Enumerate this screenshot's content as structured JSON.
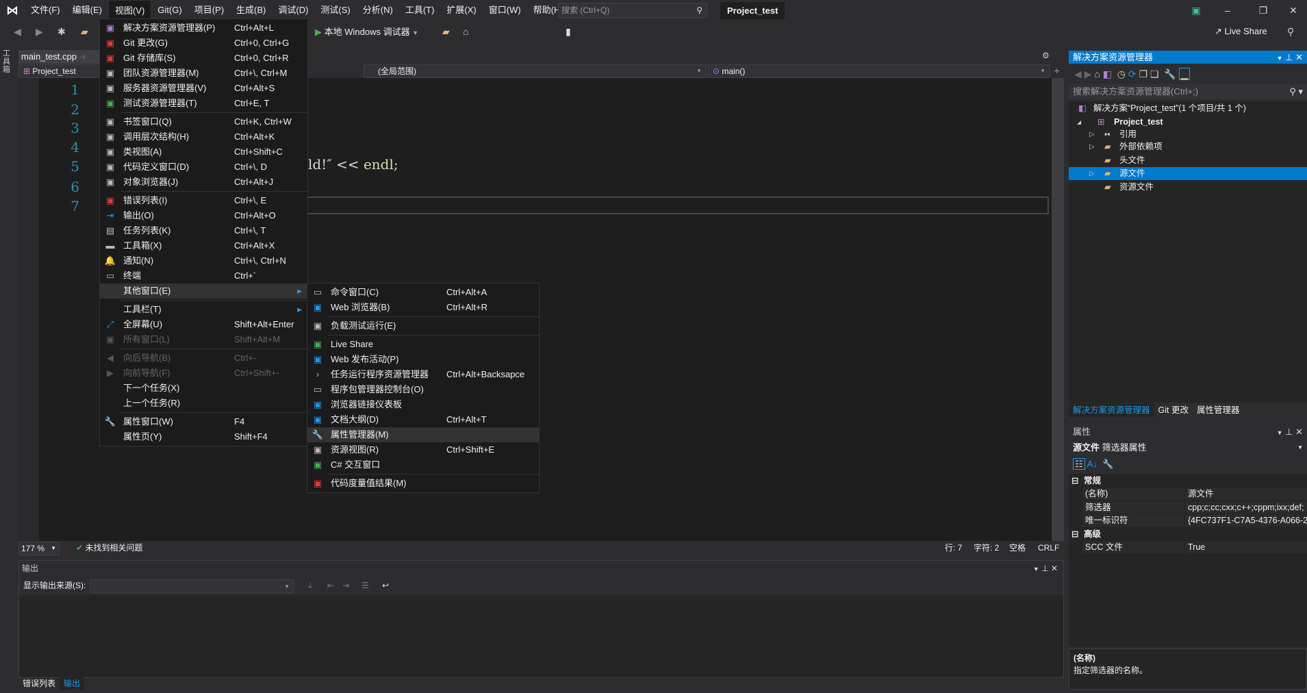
{
  "menubar": {
    "logo": "VS",
    "items": [
      "文件(F)",
      "编辑(E)",
      "视图(V)",
      "Git(G)",
      "项目(P)",
      "生成(B)",
      "调试(D)",
      "测试(S)",
      "分析(N)",
      "工具(T)",
      "扩展(X)",
      "窗口(W)",
      "帮助(H)"
    ],
    "search_placeholder": "搜索 (Ctrl+Q)",
    "title": "Project_test",
    "accent": "#007acc"
  },
  "toolbar": {
    "debug_target": "本地 Windows 调试器",
    "live_share": "Live Share"
  },
  "editor": {
    "tab": "main_test.cpp",
    "nav_project": "Project_test",
    "nav_scope": "(全局范围)",
    "nav_member": "main()",
    "line_numbers": [
      "1",
      "2",
      "3",
      "4",
      "5",
      "6",
      "7"
    ],
    "visible_code": "ld!″ << ",
    "visible_code_kw": "endl",
    "visible_code_end": ";",
    "zoom": "177 %",
    "issues": "未找到相关问题",
    "line": "行: 7",
    "char": "字符: 2",
    "spacing": "空格",
    "eol": "CRLF"
  },
  "view_menu": [
    {
      "icon": "solution-explorer",
      "label": "解决方案资源管理器(P)",
      "shortcut": "Ctrl+Alt+L"
    },
    {
      "icon": "git-changes",
      "label": "Git 更改(G)",
      "shortcut": "Ctrl+0, Ctrl+G"
    },
    {
      "icon": "git-repository",
      "label": "Git 存储库(S)",
      "shortcut": "Ctrl+0, Ctrl+R"
    },
    {
      "icon": "team-explorer",
      "label": "团队资源管理器(M)",
      "shortcut": "Ctrl+\\, Ctrl+M"
    },
    {
      "icon": "server-explorer",
      "label": "服务器资源管理器(V)",
      "shortcut": "Ctrl+Alt+S"
    },
    {
      "icon": "test-explorer",
      "label": "测试资源管理器(T)",
      "shortcut": "Ctrl+E, T"
    },
    {
      "sep": true
    },
    {
      "icon": "bookmark-window",
      "label": "书签窗口(Q)",
      "shortcut": "Ctrl+K, Ctrl+W"
    },
    {
      "icon": "call-hierarchy",
      "label": "调用层次结构(H)",
      "shortcut": "Ctrl+Alt+K"
    },
    {
      "icon": "class-view",
      "label": "类视图(A)",
      "shortcut": "Ctrl+Shift+C"
    },
    {
      "icon": "code-definition",
      "label": "代码定义窗口(D)",
      "shortcut": "Ctrl+\\, D"
    },
    {
      "icon": "object-browser",
      "label": "对象浏览器(J)",
      "shortcut": "Ctrl+Alt+J"
    },
    {
      "sep": true
    },
    {
      "icon": "error-list",
      "label": "错误列表(I)",
      "shortcut": "Ctrl+\\, E"
    },
    {
      "icon": "output",
      "label": "输出(O)",
      "shortcut": "Ctrl+Alt+O"
    },
    {
      "icon": "task-list",
      "label": "任务列表(K)",
      "shortcut": "Ctrl+\\, T"
    },
    {
      "icon": "toolbox",
      "label": "工具箱(X)",
      "shortcut": "Ctrl+Alt+X"
    },
    {
      "icon": "bell",
      "label": "通知(N)",
      "shortcut": "Ctrl+\\, Ctrl+N"
    },
    {
      "icon": "terminal",
      "label": "终端",
      "shortcut": "Ctrl+`"
    },
    {
      "label": "其他窗口(E)",
      "submenu": true,
      "highlight": true
    },
    {
      "sep": true
    },
    {
      "label": "工具栏(T)",
      "submenu": true
    },
    {
      "icon": "fullscreen",
      "label": "全屏幕(U)",
      "shortcut": "Shift+Alt+Enter"
    },
    {
      "icon": "all-windows",
      "label": "所有窗口(L)",
      "shortcut": "Shift+Alt+M",
      "disabled": true
    },
    {
      "sep": true
    },
    {
      "icon": "navigate-back",
      "label": "向后导航(B)",
      "shortcut": "Ctrl+-",
      "disabled": true
    },
    {
      "icon": "navigate-forward",
      "label": "向前导航(F)",
      "shortcut": "Ctrl+Shift+-",
      "disabled": true
    },
    {
      "label": "下一个任务(X)"
    },
    {
      "label": "上一个任务(R)"
    },
    {
      "sep": true
    },
    {
      "icon": "wrench",
      "label": "属性窗口(W)",
      "shortcut": "F4"
    },
    {
      "label": "属性页(Y)",
      "shortcut": "Shift+F4"
    }
  ],
  "other_windows_menu": [
    {
      "icon": "command-window",
      "label": "命令窗口(C)",
      "shortcut": "Ctrl+Alt+A"
    },
    {
      "icon": "web-browser",
      "label": "Web 浏览器(B)",
      "shortcut": "Ctrl+Alt+R"
    },
    {
      "sep": true
    },
    {
      "icon": "load-test",
      "label": "负载测试运行(E)"
    },
    {
      "sep": true
    },
    {
      "icon": "live-share",
      "label": "Live Share"
    },
    {
      "icon": "web-publish",
      "label": "Web 发布活动(P)"
    },
    {
      "icon": "chevron-right",
      "label": "任务运行程序资源管理器",
      "shortcut": "Ctrl+Alt+Backsapce"
    },
    {
      "icon": "package-console",
      "label": "程序包管理器控制台(O)"
    },
    {
      "icon": "browser-link",
      "label": "浏览器链接仪表板"
    },
    {
      "icon": "document-outline",
      "label": "文档大纲(D)",
      "shortcut": "Ctrl+Alt+T"
    },
    {
      "icon": "wrench",
      "label": "属性管理器(M)",
      "highlight": true
    },
    {
      "icon": "resource-view",
      "label": "资源视图(R)",
      "shortcut": "Ctrl+Shift+E"
    },
    {
      "icon": "csharp-interactive",
      "label": "C# 交互窗口"
    },
    {
      "sep": true
    },
    {
      "icon": "code-metrics",
      "label": "代码度量值结果(M)"
    }
  ],
  "solution_explorer": {
    "title": "解决方案资源管理器",
    "search_placeholder": "搜索解决方案资源管理器(Ctrl+;)",
    "tree": [
      {
        "label": "解决方案“Project_test”(1 个项目/共 1 个)",
        "level": 0,
        "icon": "solution"
      },
      {
        "label": "Project_test",
        "level": 1,
        "icon": "project",
        "expanded": true,
        "bold": true
      },
      {
        "label": "引用",
        "level": 2,
        "icon": "references",
        "collapsed": true
      },
      {
        "label": "外部依赖项",
        "level": 2,
        "icon": "folder",
        "collapsed": true
      },
      {
        "label": "头文件",
        "level": 2,
        "icon": "filter-folder"
      },
      {
        "label": "源文件",
        "level": 2,
        "icon": "filter-folder",
        "collapsed": true,
        "selected": true
      },
      {
        "label": "资源文件",
        "level": 2,
        "icon": "filter-folder"
      }
    ],
    "tabs": [
      "解决方案资源管理器",
      "Git 更改",
      "属性管理器"
    ]
  },
  "properties": {
    "title": "属性",
    "object": "源文件",
    "object_type": "筛选器属性",
    "rows": [
      {
        "category": "常规"
      },
      {
        "key": "(名称)",
        "value": "源文件"
      },
      {
        "key": "筛选器",
        "value": "cpp;c;cc;cxx;c++;cppm;ixx;def;"
      },
      {
        "key": "唯一标识符",
        "value": "{4FC737F1-C7A5-4376-A066-2"
      },
      {
        "category": "高级"
      },
      {
        "key": "SCC 文件",
        "value": "True"
      }
    ],
    "desc_title": "(名称)",
    "desc_text": "指定筛选器的名称。"
  },
  "output": {
    "title": "输出",
    "source_label": "显示输出来源(S):",
    "source_value": ""
  },
  "bottom_tabs": [
    "错误列表",
    "输出"
  ]
}
